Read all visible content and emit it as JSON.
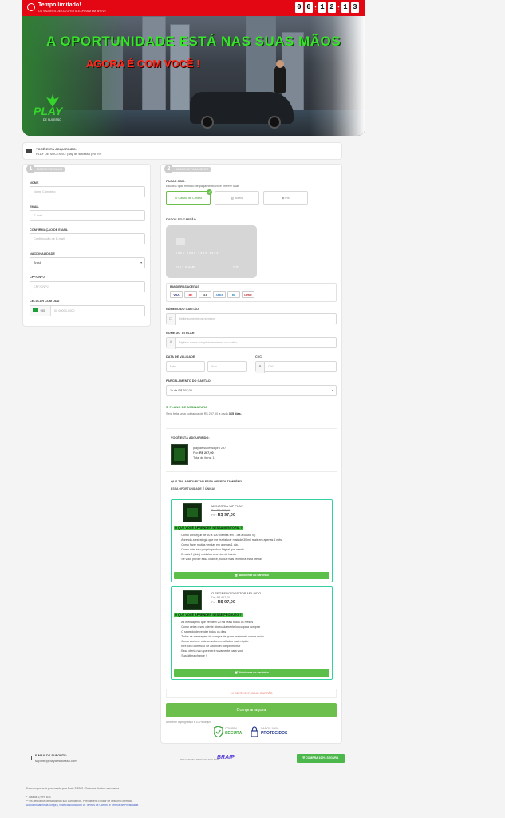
{
  "timer": {
    "title": "Tempo limitado!",
    "subtitle": "OS VALORES DESTA OFERTA EXPIRAM EM BREVE",
    "digits": [
      "0",
      "0",
      "1",
      "2",
      "1",
      "3"
    ]
  },
  "banner": {
    "headline": "A OPORTUNIDADE ESTÁ NAS SUAS MÃOS",
    "subheadline": "AGORA É COM VOCÊ !",
    "logo_text": "PLAY",
    "logo_sub": "DE SUCESSO"
  },
  "product_bar": {
    "label": "VOCÊ ESTÁ ADQUIRINDO:",
    "value": "PLAY DE SUCESSO: play de sucesso pro 297"
  },
  "step1": {
    "number": "1",
    "pill": "DADOS PESSOAIS",
    "fields": {
      "name_label": "NOME",
      "name_placeholder": "Nome Completo",
      "email_label": "EMAIL",
      "email_placeholder": "E-mail",
      "email_confirm_label": "CONFIRMAÇÃO DE EMAIL",
      "email_confirm_placeholder": "Confirmação de E-mail",
      "nationality_label": "NACIONALIDADE",
      "nationality_value": "Brasil",
      "cpf_label": "CPF/CNPJ",
      "cpf_placeholder": "CPF/CNPJ",
      "phone_label": "CELULAR COM DDD",
      "phone_code": "+55",
      "phone_placeholder": "00 00000-0000"
    }
  },
  "step2": {
    "number": "2",
    "pill": "DADOS DE PAGAMENTO",
    "pay_with": "PAGAR COM:",
    "pay_hint": "Escolha qual método de pagamento você prefere usar.",
    "methods": [
      "Cartão de Crédito",
      "Boleto",
      "Pix"
    ],
    "card_section": "DADOS DO CARTÃO",
    "card_mock_number": "**** **** **** ****",
    "card_mock_name": "FULL NAME",
    "card_mock_exp": "**/**",
    "brands_label": "BANDEIRAS ACEITAS",
    "brands": [
      "VISA",
      "MC",
      "ELO",
      "AMEX",
      "DC",
      "HIPER"
    ],
    "card_number_label": "NÚMERO DO CARTÃO",
    "card_number_placeholder": "Digite somente os números",
    "holder_label": "NOME DO TITULAR",
    "holder_placeholder": "Digite o nome completo impresso no cartão",
    "validity_label": "DATA DE VALIDADE",
    "month_placeholder": "Mês",
    "year_placeholder": "Ano",
    "cvc_label": "CVC",
    "cvc_placeholder": "CVC",
    "installments_label": "PARCELAMENTO DO CARTÃO",
    "installments_value": "1x de R$ 297,00",
    "plan_title": "PLANO DE ASSINATURA",
    "plan_text": "Será feita uma cobrança de R$ 297,00 a cada",
    "plan_days": "365 dias."
  },
  "summary": {
    "title": "VOCÊ ESTÁ ADQUIRINDO:",
    "item_name": "play de sucesso pro 297",
    "price_prefix": "Por:",
    "price": "R$ 297,00",
    "items": "Total de itens: 1"
  },
  "upsell": {
    "question": "QUE TAL APROVEITAR ESSA OFERTA TAMBÉM?",
    "note": "ESSA OPORTUNIDADE É ÚNICA!",
    "offers": [
      {
        "title": "MENTORIA VIP PLAY",
        "from": "De: R$ 497,00",
        "to_prefix": "Por:",
        "to": "R$ 97,00",
        "highlight": "O QUE VOCÊ APRENDER NESSA MENTORIA ?",
        "bullets": [
          "Como conseguir de 50 a 100 clientes em 1 dia a custo( 0 )",
          "Aprenda a estratégia que me fez faturar mais de 30 mil reais em apenas 1 mês",
          "Como fazer muitas vendas em apenas 1 dia.",
          "Como criar seu próprio produto Digital que vende",
          "E mais 2 (dois) módulos secretos de brinde",
          "Se você perder essa chance, nunca mais receberá essa oferta!"
        ],
        "button": "Adicionar ao carrinho"
      },
      {
        "title": "O SEGREDO DOS TOP AFILIADO",
        "from": "De: R$ 997,00",
        "to_prefix": "Por:",
        "to": "R$ 97,00",
        "highlight": "O QUE VOCÊ APRENDER NESSE PRODUTO ?",
        "bullets": [
          "As mensagens que vendem 20 mil reais todos os meses",
          "Como deixa o seu cliente obcecadamente louco para comprar",
          "O segredo de vender todos os dias",
          "Todas as mensagem de compra de quem realmente vende muito",
          "Como acelerar o desenvolver resultados mais rápido",
          "fore todo conteúdo de alto nível complementar",
          "Essa oferta não aparecerá novamente para você",
          "Sua última chance !"
        ],
        "button": "Adicionar ao carrinho"
      }
    ]
  },
  "total_line": "1X DE R$ 297,00 NO CARTÃO",
  "buy_button": "Comprar agora",
  "secure_note": "Ambiente criptografado e 100% seguro",
  "seals": {
    "secure1": "COMPRA",
    "secure2": "SEGURA",
    "data1": "DADOS 100%",
    "data2": "PROTEGIDOS"
  },
  "footer": {
    "support_label": "E-MAIL DE SUPORTE:",
    "support_email": "suporte@playdesucesso.com",
    "processed_by": "PAGAMENTO PROCESSADO POR",
    "braip": "BRAIP",
    "badge": "COMPRA 100% SEGURA",
    "line1": "Esta compra será processada pela Braip © 2022 - Todos os direitos reservados",
    "line2": "* Taxa de 2,99% a.m.",
    "line3": "** Os descontos ofertados não são cumulativos. Prevalecerá o maior de desconto ofertado.",
    "line4": "Ao continuar nesta compra, você concorda com os Termos de Compra e Termos de Privacidade."
  },
  "colors": {
    "red": "#e30613",
    "green": "#6cbf4c",
    "offer_border": "#33d1a0"
  }
}
